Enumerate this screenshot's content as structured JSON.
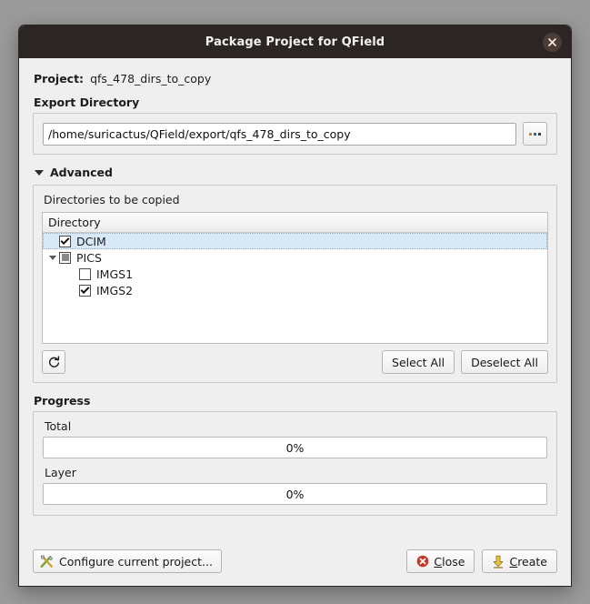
{
  "window": {
    "title": "Package Project for QField",
    "close_icon": "close-icon"
  },
  "project": {
    "label": "Project:",
    "value": "qfs_478_dirs_to_copy"
  },
  "export_directory": {
    "label": "Export Directory",
    "path_value": "/home/suricactus/QField/export/qfs_478_dirs_to_copy",
    "path_placeholder": "",
    "browse_label": "...",
    "browse_icon": "ellipsis-icon"
  },
  "advanced": {
    "label": "Advanced",
    "expanded": true,
    "toggle_icon": "chevron-down-icon"
  },
  "directories": {
    "caption": "Directories to be copied",
    "column_header": "Directory",
    "items": [
      {
        "name": "DCIM",
        "state": "checked",
        "depth": 0,
        "selected": true,
        "expandable": false
      },
      {
        "name": "PICS",
        "state": "partial",
        "depth": 0,
        "selected": false,
        "expandable": true
      },
      {
        "name": "IMGS1",
        "state": "unchecked",
        "depth": 1,
        "selected": false,
        "expandable": false
      },
      {
        "name": "IMGS2",
        "state": "checked",
        "depth": 1,
        "selected": false,
        "expandable": false
      }
    ],
    "refresh_icon": "refresh-icon",
    "select_all_label": "Select All",
    "deselect_all_label": "Deselect All"
  },
  "progress": {
    "label": "Progress",
    "total": {
      "label": "Total",
      "text": "0%",
      "percent": 0
    },
    "layer": {
      "label": "Layer",
      "text": "0%",
      "percent": 0
    }
  },
  "footer": {
    "configure_label": "Configure current project...",
    "configure_icon": "tools-icon",
    "close_label": "Close",
    "close_icon": "error-circle-icon",
    "create_label": "Create",
    "create_icon": "download-arrow-icon"
  },
  "colors": {
    "titlebar": "#2b2523",
    "dialog_bg": "#efefef",
    "selection": "#d7e8f6",
    "desktop": "#9b9b9b",
    "close_red": "#c0392b",
    "create_yellow": "#e9c44a"
  }
}
